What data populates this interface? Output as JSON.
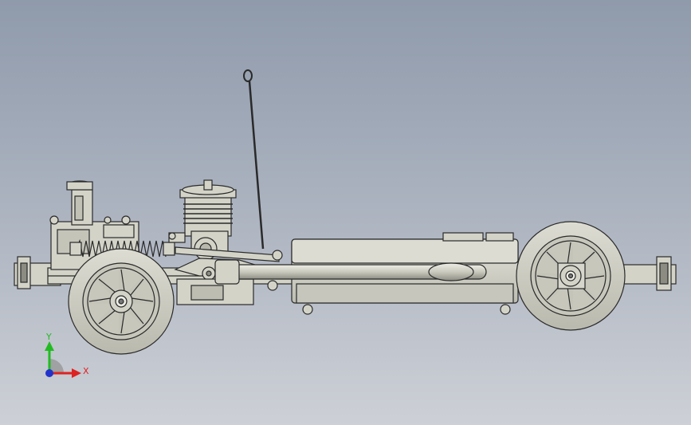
{
  "viewport": {
    "background_top": "#8f9aab",
    "background_bottom": "#cdd0d6"
  },
  "model": {
    "name": "rc-car-chassis-side-view",
    "part_color": "#d3d3c8",
    "edge_color": "#2a2a2a",
    "shade_color": "#a9a99e"
  },
  "triad": {
    "y_label": "Y",
    "x_label": "X",
    "y_color": "#22bb22",
    "x_color": "#dd2222",
    "z_color": "#2233cc"
  }
}
